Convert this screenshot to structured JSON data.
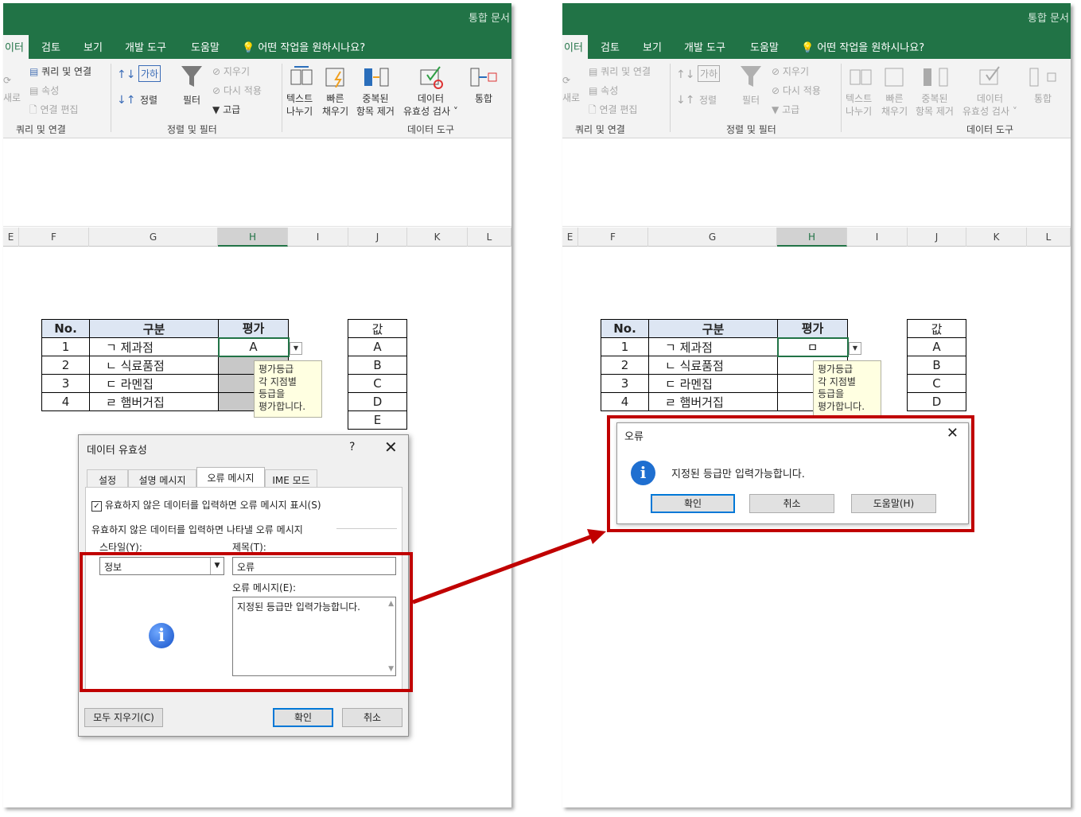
{
  "window": {
    "doc_title": "통합 문서"
  },
  "tabs": [
    "이터",
    "검토",
    "보기",
    "개발 도구",
    "도움말",
    "어떤 작업을 원하시나요?"
  ],
  "ribbon": {
    "query_items": [
      "쿼리 및 연결",
      "속성",
      "연결 편집"
    ],
    "refresh_label": "새로",
    "query_group": "쿼리 및 연결",
    "sort_label": "정렬",
    "filter_label": "필터",
    "filter_items": [
      "지우기",
      "다시 적용",
      "고급"
    ],
    "sort_group": "정렬 및 필터",
    "tools": [
      {
        "line1": "텍스트",
        "line2": "나누기"
      },
      {
        "line1": "빠른",
        "line2": "채우기"
      },
      {
        "line1": "중복된",
        "line2": "항목 제거"
      },
      {
        "line1": "데이터",
        "line2": "유효성 검사 ˅"
      },
      {
        "line1": "통합",
        "line2": ""
      }
    ],
    "tools_group": "데이터 도구"
  },
  "columns": [
    "E",
    "F",
    "G",
    "H",
    "I",
    "J",
    "K",
    "L"
  ],
  "table": {
    "headers": [
      "No.",
      "구분",
      "평가"
    ],
    "rows": [
      {
        "no": "1",
        "name": "ㄱ 제과점"
      },
      {
        "no": "2",
        "name": "ㄴ 식료품점"
      },
      {
        "no": "3",
        "name": "ㄷ 라멘집"
      },
      {
        "no": "4",
        "name": "ㄹ 햄버거집"
      }
    ],
    "left_value": "A",
    "right_value": "ㅁ"
  },
  "values_list": {
    "header": "값",
    "items": [
      "A",
      "B",
      "C",
      "D",
      "E"
    ]
  },
  "tooltip": {
    "lines": [
      "평가등급",
      "각 지점별",
      "등급을",
      "평가합니다."
    ]
  },
  "validation_dialog": {
    "title": "데이터 유효성",
    "help": "?",
    "close": "✕",
    "tabs": [
      "설정",
      "설명 메시지",
      "오류 메시지",
      "IME 모드"
    ],
    "checkbox_label": "유효하지 않은 데이터를 입력하면 오류 메시지 표시(S)",
    "section_label": "유효하지 않은 데이터를 입력하면 나타낼 오류 메시지",
    "style_label": "스타일(Y):",
    "style_value": "정보",
    "title_label": "제목(T):",
    "title_value": "오류",
    "message_label": "오류 메시지(E):",
    "message_value": "지정된 등급만 입력가능합니다.",
    "clear_all": "모두 지우기(C)",
    "ok": "확인",
    "cancel": "취소"
  },
  "error_dialog": {
    "title": "오류",
    "close": "✕",
    "message": "지정된 등급만 입력가능합니다.",
    "ok": "확인",
    "cancel": "취소",
    "help": "도움말(H)"
  },
  "colors": {
    "excel_green": "#217346",
    "highlight_red": "#c00000",
    "header_blue": "#dde6f3"
  }
}
